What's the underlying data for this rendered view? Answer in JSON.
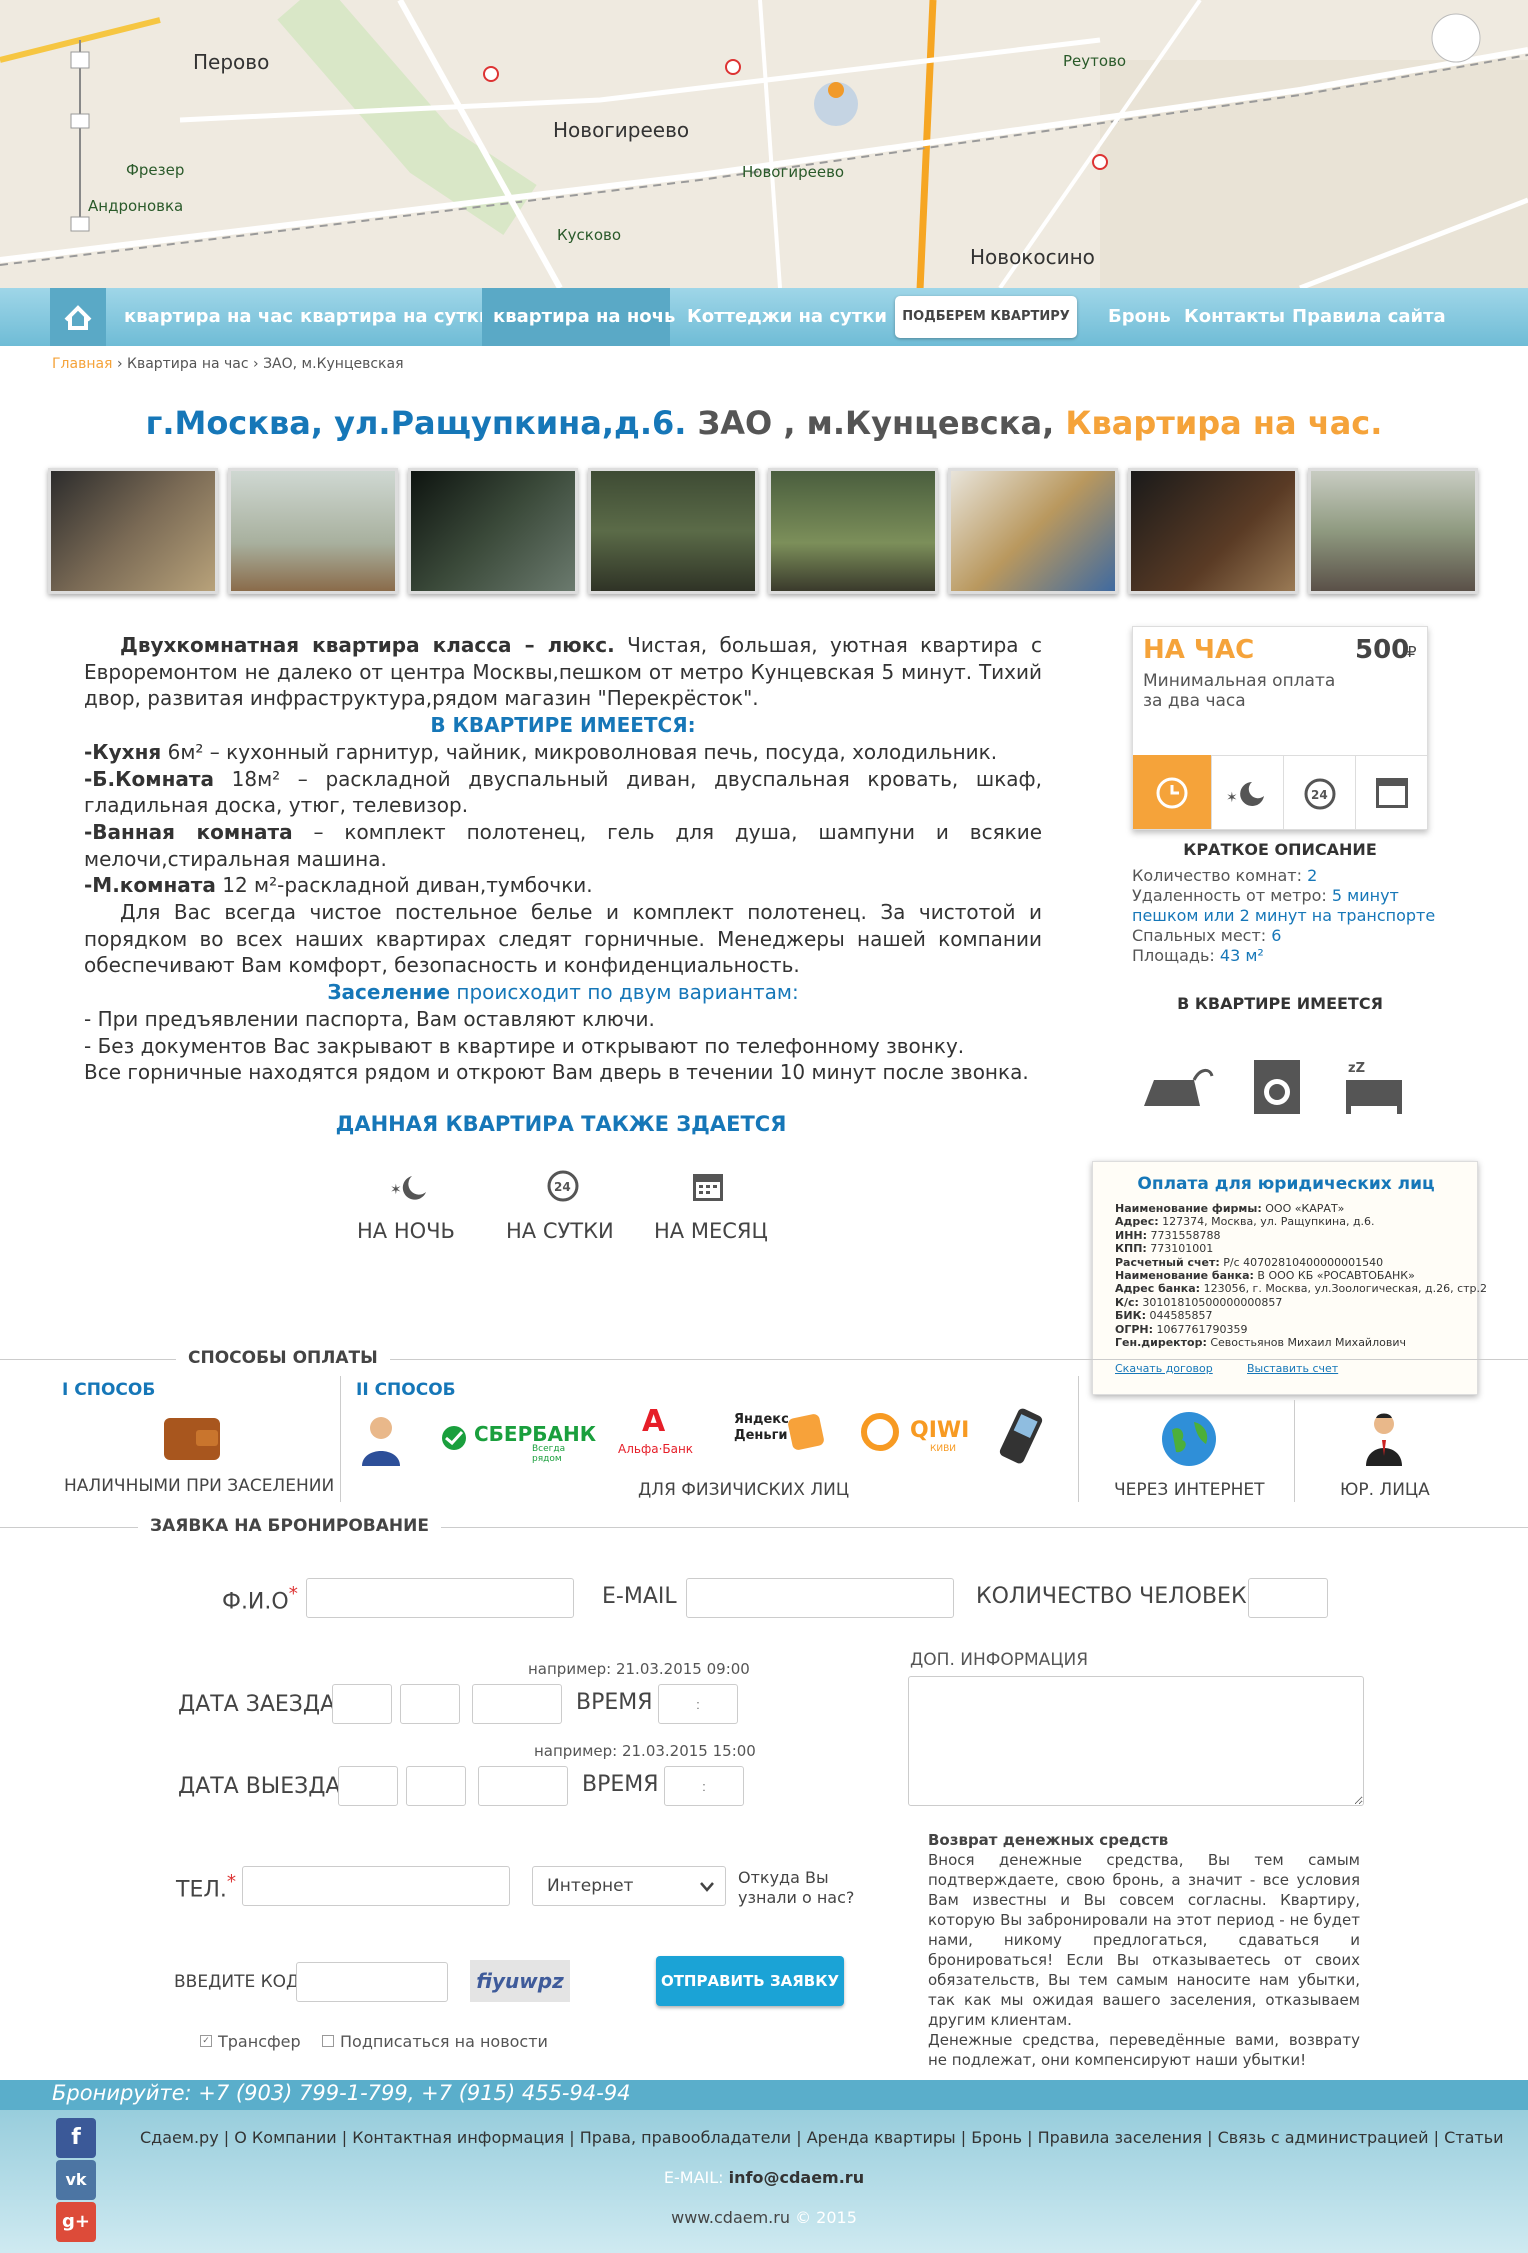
{
  "map": {
    "places": [
      "Перово",
      "Новогиреево",
      "Новокосино",
      "Реутово",
      "Фрезер",
      "Андроновка",
      "Новогиреево",
      "Кусково"
    ]
  },
  "nav": {
    "items": [
      "квартира на час",
      "квартира на сутки",
      "квартира на ночь",
      "Коттеджи на сутки"
    ],
    "pick_button": "ПОДБЕРЕМ КВАРТИРУ",
    "right_items": [
      "Бронь",
      "Контакты",
      "Правила сайта"
    ]
  },
  "breadcrumb": {
    "home": "Главная",
    "level2": "Квартира на час",
    "level3": "ЗАО, м.Кунцевская"
  },
  "title": {
    "part1": "г.Москва, ул.Ращупкина,д.6.",
    "part2": "ЗАО , м.Кунцевска,",
    "part3": "Квартира на час."
  },
  "description": {
    "p1_bold": "Двухкомнатная квартира класса – люкс.",
    "p1_rest": " Чистая, большая, уютная квартира с Евроремонтом не далеко от центра Москвы,пешком от метро Кунцевская 5 минут. Тихий двор, развитая инфраструктура,рядом магазин \"Перекрёсток\".",
    "has_heading": "В КВАРТИРЕ ИМЕЕТСЯ:",
    "kitchen_bold": "-Кухня",
    "kitchen_rest": " 6м² – кухонный гарнитур, чайник, микроволновая печь, посуда, холодильник.",
    "room_bold": "-Б.Комната",
    "room_rest": " 18м² – раскладной двуспальный диван, двуспальная кровать, шкаф, гладильная доска, утюг, телевизор.",
    "bath_bold": "-Ванная комната",
    "bath_rest": " – комплект полотенец, гель для душа, шампуни и всякие мелочи,стиральная машина.",
    "mroom_bold": "-М.комната",
    "mroom_rest": " 12 м²-раскладной диван,тумбочки.",
    "p_clean": "Для Вас всегда чистое постельное белье и комплект полотенец. За чистотой и порядком во всех наших квартирах следят горничные. Менеджеры нашей компании обеспечивают Вам комфорт, безопасность и конфиденциальность.",
    "settle_bold": "Заселение",
    "settle_rest": " происходит по двум вариантам:",
    "opt1": "- При предъявлении паспорта, Вам оставляют ключи.",
    "opt2": "- Без документов Вас закрывают в квартире и открывают по телефонному звонку.",
    "maids": "Все горничные находятся рядом и откроют Вам дверь в течении 10 минут после звонка."
  },
  "also": {
    "heading": "ДАННАЯ КВАРТИРА ТАКЖЕ ЗДАЕТСЯ",
    "night": "НА НОЧЬ",
    "day": "НА СУТКИ",
    "month": "НА МЕСЯЦ"
  },
  "price_card": {
    "label": "НА ЧАС",
    "price": "500",
    "currency": "₽",
    "note1": "Минимальная оплата",
    "note2": "за два часа"
  },
  "summary": {
    "heading": "КРАТКОЕ ОПИСАНИЕ",
    "rooms_label": "Количество комнат:",
    "rooms": "2",
    "metro_label": "Удаленность от метро:",
    "metro1": "5 минут",
    "metro2": "пешком  или 2 минут на транспорте",
    "beds_label": "Спальных мест:",
    "beds": "6",
    "area_label": "Площадь:",
    "area": "43 м²",
    "amenities_heading": "В КВАРТИРЕ ИМЕЕТСЯ"
  },
  "legal_popup": {
    "title": "Оплата для юридических лиц",
    "rows": [
      {
        "k": "Наименование фирмы:",
        "v": " ООО «КАРАТ»"
      },
      {
        "k": "Адрес:",
        "v": " 127374, Москва, ул. Ращупкина, д.6."
      },
      {
        "k": "ИНН:",
        "v": " 7731558788"
      },
      {
        "k": "КПП:",
        "v": " 773101001"
      },
      {
        "k": "Расчетный счет:",
        "v": " Р/с 40702810400000001540"
      },
      {
        "k": "Наименование банка:",
        "v": " В ООО КБ «РОСАВТОБАНК»"
      },
      {
        "k": "Адрес банка:",
        "v": " 123056, г. Москва, ул.Зоологическая, д.26, стр.2"
      },
      {
        "k": "К/с:",
        "v": " 30101810500000000857"
      },
      {
        "k": "БИК:",
        "v": " 044585857"
      },
      {
        "k": "ОГРН:",
        "v": " 1067761790359"
      },
      {
        "k": "Ген.директор:",
        "v": " Севостьянов Михаил Михайлович"
      }
    ],
    "download": "Скачать договор",
    "invoice": "Выставить счет"
  },
  "payment": {
    "heading": "СПОСОБЫ ОПЛАТЫ",
    "way1": "I СПОСОБ",
    "way1_caption": "НАЛИЧНЫМИ ПРИ ЗАСЕЛЕНИИ",
    "way2": "II СПОСОБ",
    "way2_caption": "ДЛЯ ФИЗИЧИСКИХ ЛИЦ",
    "way3_caption": "ЧЕРЕЗ ИНТЕРНЕТ",
    "way4_caption": "ЮР. ЛИЦА",
    "sber": "СБЕРБАНК",
    "sber_sub": "Всегда рядом",
    "alfa": "Альфа·Банк",
    "yandex": "Яндекс Деньги",
    "qiwi": "QIWI",
    "qiwi_sub": "КИВИ"
  },
  "booking": {
    "heading": "ЗАЯВКА НА БРОНИРОВАНИЕ",
    "fio": "Ф.И.О",
    "email": "E-MAIL",
    "people": "КОЛИЧЕСТВО ЧЕЛОВЕК",
    "example1": "например:  21.03.2015   09:00",
    "example2": "например:  21.03.2015   15:00",
    "checkin": "ДАТА ЗАЕЗДА",
    "checkout": "ДАТА ВЫЕЗДА",
    "time": "ВРЕМЯ",
    "time_ph": ":",
    "extra": "ДОП. ИНФОРМАЦИЯ",
    "phone": "ТЕЛ.",
    "source_value": "Интернет",
    "source_label1": "Откуда Вы",
    "source_label2": "узнали о нас?",
    "code": "ВВЕДИТЕ КОД",
    "captcha": "fiyuwpz",
    "submit": "ОТПРАВИТЬ ЗАЯВКУ",
    "transfer": "Трансфер",
    "subscribe": "Подписаться на новости",
    "refund_title": "Возврат денежных средств",
    "refund_text": "Внося денежные средства, Вы тем самым подтверждаете, свою бронь, а значит - все условия Вам известны и Вы совсем согласны. Квартиру, которую Вы забронировали на этот период - не будет нами, никому предлогаться, сдаваться и бронироваться! Если Вы отказываетесь от своих обязательств, Вы тем самым наносите нам убытки, так как мы ожидая вашего заселения, отказываем другим клиентам.",
    "refund_text2": "Денежные средства, переведённые вами, возврату не подлежат, они компенсируют наши убытки!"
  },
  "footer": {
    "phones": "Бронируйте: +7 (903) 799-1-799, +7 (915) 455-94-94",
    "links": [
      "Сдаем.ру",
      "О Компании",
      "Контактная информация",
      "Права, правообладатели",
      "Аренда квартиры",
      "Бронь",
      "Правила заселения",
      "Связь с администрацией",
      "Статьи"
    ],
    "email_label": "E-MAIL:",
    "email": "info@cdaem.ru",
    "site": "www.cdaem.ru",
    "copy": "© 2015"
  },
  "colors": {
    "accent": "#1677b8",
    "orange": "#f5a33a",
    "nav": "#7cc4dc"
  }
}
